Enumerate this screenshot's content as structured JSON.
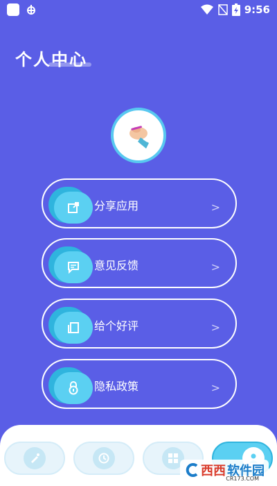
{
  "status_bar": {
    "time": "9:56",
    "bug_icon": "bug-icon",
    "icons": [
      "wifi-icon",
      "no-sim-icon",
      "battery-charging-icon"
    ]
  },
  "page": {
    "title": "个人中心"
  },
  "avatar": {
    "icon": "hand-icon"
  },
  "menu": {
    "items": [
      {
        "label": "分享应用",
        "icon": "share-icon"
      },
      {
        "label": "意见反馈",
        "icon": "feedback-icon"
      },
      {
        "label": "给个好评",
        "icon": "copy-icon"
      },
      {
        "label": "隐私政策",
        "icon": "lock-icon"
      }
    ],
    "chevron": ">"
  },
  "bottom_nav": {
    "tabs": [
      "brush-icon",
      "clock-icon",
      "grid-icon",
      "user-icon"
    ],
    "active_index": 3
  },
  "watermark": {
    "brand_a": "西西",
    "brand_b": "软件园",
    "url": "CR173.COM"
  },
  "colors": {
    "background": "#5A5EE6",
    "accent": "#5BD0F2",
    "accent_dark": "#2FB4DE"
  }
}
